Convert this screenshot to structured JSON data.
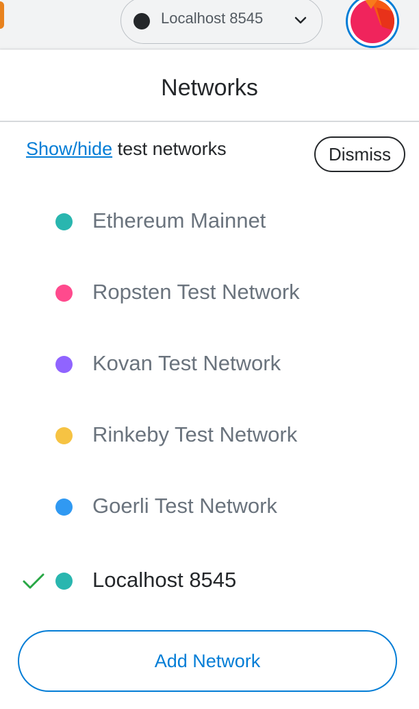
{
  "topbar": {
    "current_network": "Localhost 8545",
    "current_network_color": "#24272a",
    "chevron_icon": "chevron-down-icon",
    "avatar_icon": "account-avatar-icon"
  },
  "panel": {
    "title": "Networks",
    "notice": {
      "link_text": "Show/hide",
      "text": " test networks",
      "dismiss_label": "Dismiss"
    },
    "networks": [
      {
        "label": "Ethereum Mainnet",
        "color": "#29b6af",
        "selected": false
      },
      {
        "label": "Ropsten Test Network",
        "color": "#ff4a8d",
        "selected": false
      },
      {
        "label": "Kovan Test Network",
        "color": "#9064ff",
        "selected": false
      },
      {
        "label": "Rinkeby Test Network",
        "color": "#f6c343",
        "selected": false
      },
      {
        "label": "Goerli Test Network",
        "color": "#3099f2",
        "selected": false
      },
      {
        "label": "Localhost 8545",
        "color": "#29b6af",
        "selected": true
      }
    ],
    "add_button_label": "Add Network"
  },
  "colors": {
    "accent": "#037dd6",
    "check": "#28a745",
    "text_dark": "#24272a",
    "text_muted": "#6a737d"
  }
}
